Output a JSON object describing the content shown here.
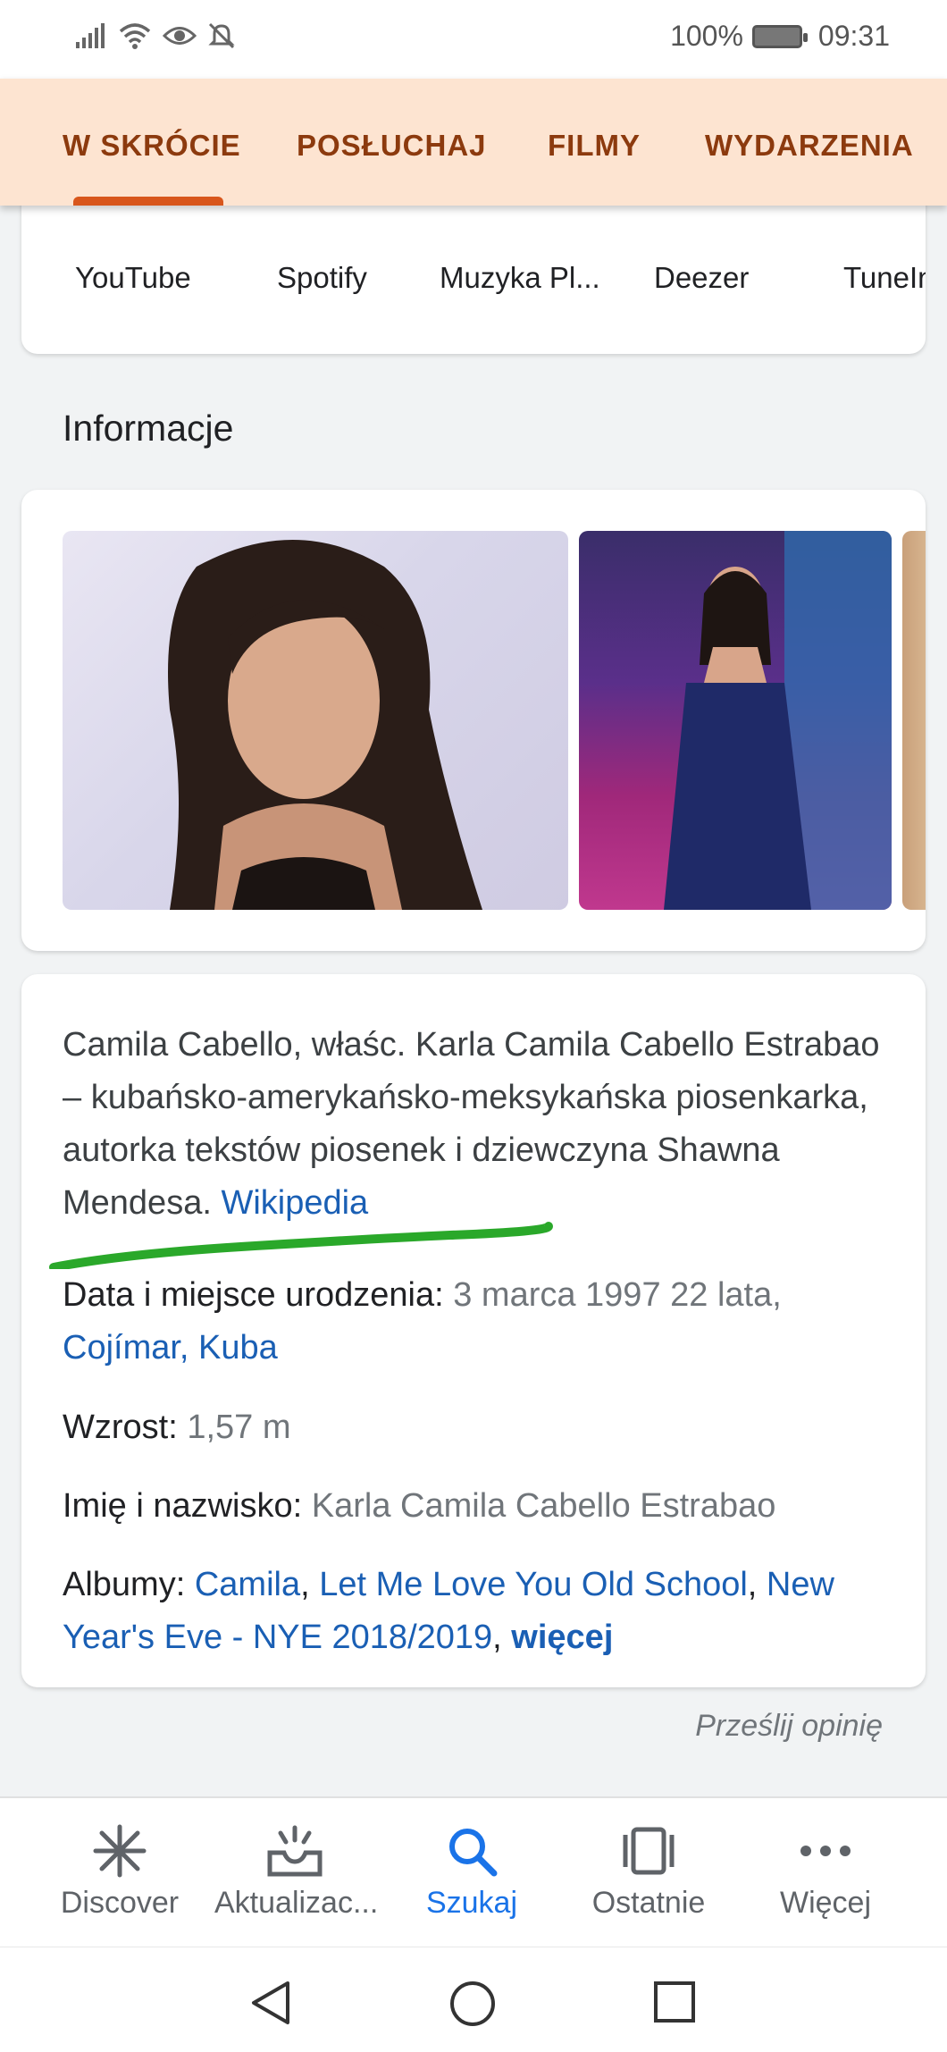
{
  "status_bar": {
    "battery_percent": "100%",
    "time": "09:31",
    "icons": [
      "signal-icon",
      "wifi-icon",
      "eye-icon",
      "bell-off-icon",
      "battery-icon"
    ]
  },
  "tabs": [
    {
      "label": "W SKRÓCIE",
      "active": true
    },
    {
      "label": "POSŁUCHAJ",
      "active": false
    },
    {
      "label": "FILMY",
      "active": false
    },
    {
      "label": "WYDARZENIA",
      "active": false
    }
  ],
  "sources": [
    {
      "label": "YouTube"
    },
    {
      "label": "Spotify"
    },
    {
      "label": "Muzyka Pl..."
    },
    {
      "label": "Deezer"
    },
    {
      "label": "TuneIn In"
    }
  ],
  "section_title": "Informacje",
  "info": {
    "description": "Camila Cabello, właśc. Karla Camila Cabello Estrabao – kubańsko-amerykańsko-meksykańska piosenkarka, autorka tekstów piosenek i dziewczyna Shawna Mendesa.",
    "description_link": "Wikipedia",
    "birth_label": "Data i miejsce urodzenia:",
    "birth_value": "3 marca 1997 22 lata,",
    "birth_place": "Cojímar, Kuba",
    "height_label": "Wzrost:",
    "height_value": "1,57 m",
    "name_label": "Imię i nazwisko:",
    "name_value": "Karla Camila Cabello Estrabao",
    "albums_label": "Albumy:",
    "album_1": "Camila",
    "album_2": "Let Me Love You Old School",
    "album_3": "New Year's Eve - NYE 2018/2019",
    "albums_more": "więcej"
  },
  "feedback": "Prześlij opinię",
  "bottom_nav": [
    {
      "label": "Discover",
      "icon": "asterisk-icon",
      "active": false
    },
    {
      "label": "Aktualizac...",
      "icon": "inbox-icon",
      "active": false
    },
    {
      "label": "Szukaj",
      "icon": "search-icon",
      "active": true
    },
    {
      "label": "Ostatnie",
      "icon": "recent-cards-icon",
      "active": false
    },
    {
      "label": "Więcej",
      "icon": "more-dots-icon",
      "active": false
    }
  ],
  "colors": {
    "tab_bar_bg": "#fde4d1",
    "tab_text": "#8c3a0e",
    "tab_indicator": "#d8561c",
    "link": "#1a5fb4",
    "nav_active": "#1a73e8",
    "highlight_stroke": "#2aa82a"
  }
}
